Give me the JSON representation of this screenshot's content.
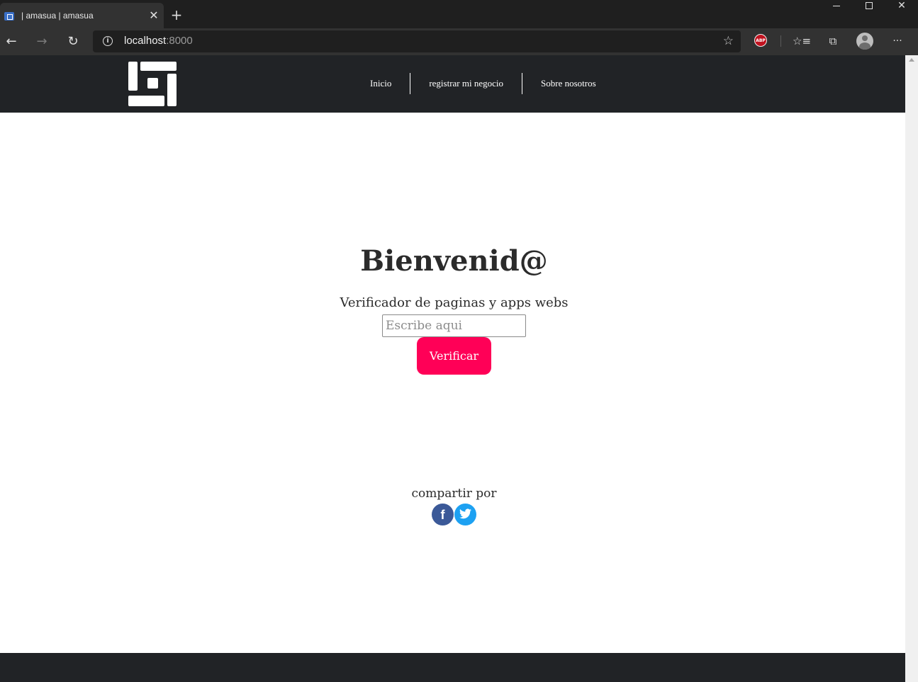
{
  "browser": {
    "tab_title": "| amasua | amasua",
    "tab_close": "✕",
    "new_tab": "+",
    "url_host": "localhost",
    "url_port": ":8000",
    "window_close": "✕",
    "abp_label": "ABP"
  },
  "site": {
    "nav": [
      "Inicio",
      "registrar mi negocio",
      "Sobre nosotros"
    ],
    "hero_title": "Bienvenid@",
    "subtitle": "Verificador de paginas y apps webs",
    "input_placeholder": "Escribe aqui",
    "verify_button": "Verificar",
    "share_label": "compartir por",
    "facebook_glyph": "f"
  },
  "colors": {
    "header_bg": "#212326",
    "accent_button": "#ff0057",
    "facebook": "#3b5998",
    "twitter": "#1da1f2"
  },
  "icons": [
    "search-icon",
    "star-icon",
    "favorites-icon",
    "collections-icon",
    "profile-icon",
    "menu-icon",
    "facebook-icon",
    "twitter-icon"
  ]
}
